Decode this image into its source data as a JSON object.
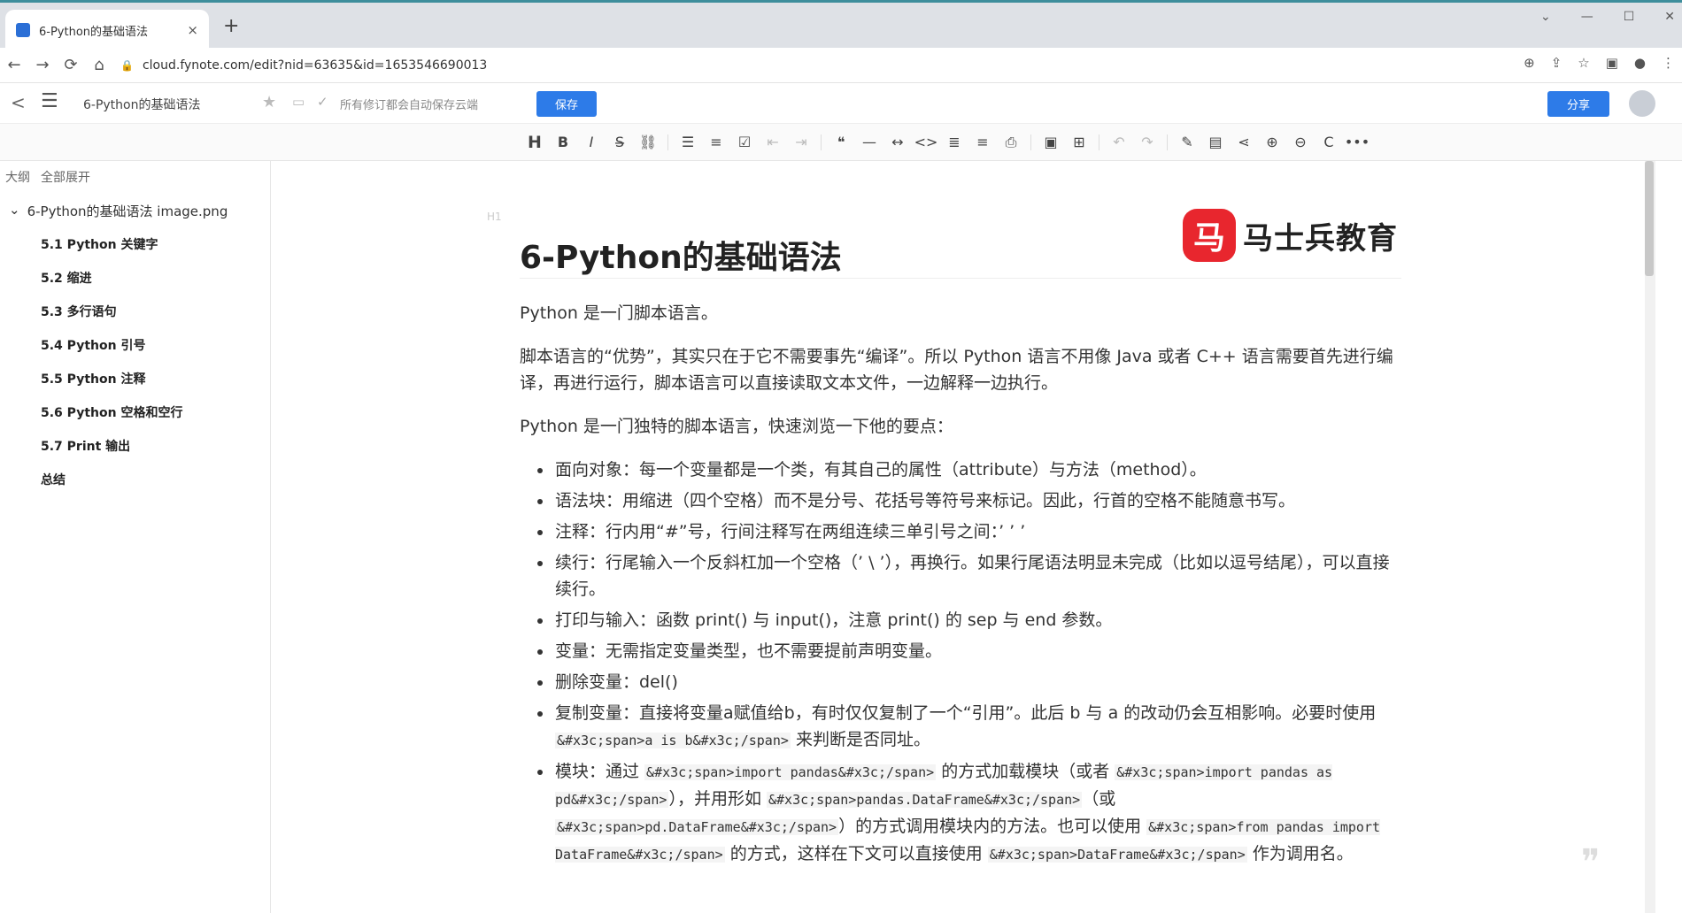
{
  "browser": {
    "tab_title": "6-Python的基础语法",
    "tab_close": "×",
    "new_tab": "+",
    "url": "cloud.fynote.com/edit?nid=63635&id=1653546690013",
    "nav": {
      "back": "←",
      "forward": "→",
      "reload": "⟳",
      "home": "⌂"
    },
    "window": {
      "chevron": "⌄",
      "minimize": "—",
      "maximize": "☐",
      "close": "✕"
    },
    "omni_icons": {
      "zoom": "⊕",
      "share": "⇪",
      "bookmark": "☆",
      "panel": "▣",
      "profile": "●",
      "more": "⋮"
    }
  },
  "header": {
    "back": "<",
    "menu": "☰",
    "doc_title": "6-Python的基础语法",
    "star": "★",
    "folder": "▭",
    "check": "✓",
    "autosave": "所有修订都会自动保存云端",
    "save_label": "保存",
    "share_label": "分享"
  },
  "toolbar": {
    "group1": [
      "H",
      "B",
      "I",
      "S̶",
      "⛓"
    ],
    "group2": [
      "☰",
      "≡",
      "☑",
      "⇤",
      "⇥"
    ],
    "group3": [
      "❝",
      "—",
      "↔",
      "<>",
      "≣",
      "≡",
      "⎙"
    ],
    "group4": [
      "▣",
      "⊞"
    ],
    "group5": [
      "↶",
      "↷"
    ],
    "group6": [
      "✎",
      "▤",
      "⋖",
      "⊕",
      "⊖",
      "C",
      "•••"
    ]
  },
  "sidebar": {
    "outline_label": "大纲",
    "expand_all_label": "全部展开",
    "root_chevron": "⌄",
    "root_label": "6-Python的基础语法 image.png",
    "items": [
      {
        "label": "5.1 Python 关键字"
      },
      {
        "label": "5.2 缩进"
      },
      {
        "label": "5.3 多行语句"
      },
      {
        "label": "5.4 Python 引号"
      },
      {
        "label": "5.5 Python 注释"
      },
      {
        "label": "5.6 Python 空格和空行"
      },
      {
        "label": "5.7 Print 输出"
      },
      {
        "label": "总结"
      }
    ]
  },
  "doc": {
    "h1_label": "H1",
    "title": "6-Python的基础语法",
    "logo_mark": "马",
    "logo_text": "马士兵教育",
    "p1": "Python 是一门脚本语言。",
    "p2": "脚本语言的“优势”，其实只在于它不需要事先“编译”。所以 Python 语言不用像 Java 或者 C++ 语言需要首先进行编译，再进行运行，脚本语言可以直接读取文本文件，一边解释一边执行。",
    "p3": "Python 是一门独特的脚本语言，快速浏览一下他的要点：",
    "bullets": [
      {
        "text": "面向对象：每一个变量都是一个类，有其自己的属性（attribute）与方法（method）。"
      },
      {
        "text": "语法块：用缩进（四个空格）而不是分号、花括号等符号来标记。因此，行首的空格不能随意书写。"
      },
      {
        "text": "注释：行内用“#”号，行间注释写在两组连续三单引号之间：’ ’ ’"
      },
      {
        "text": "续行：行尾输入一个反斜杠加一个空格（’ \\ ’），再换行。如果行尾语法明显未完成（比如以逗号结尾），可以直接续行。"
      },
      {
        "text": "打印与输入：函数 print() 与 input()，注意 print() 的 sep 与 end 参数。"
      },
      {
        "text": "变量：无需指定变量类型，也不需要提前声明变量。"
      },
      {
        "text": "删除变量：del()"
      }
    ],
    "copy_bullet": {
      "t1": "复制变量：直接将变量a赋值给b，有时仅仅复制了一个“引用”。此后 b 与 a 的改动仍会互相影响。必要时使用 ",
      "c1": "&#x3c;span>a is b&#x3c;/span>",
      "t2": " 来判断是否同址。"
    },
    "module_bullet": {
      "t1": "模块：通过 ",
      "c1": "&#x3c;span>import pandas&#x3c;/span>",
      "t2": " 的方式加载模块（或者 ",
      "c2": "&#x3c;span>import pandas as pd&#x3c;/span>",
      "t3": "），并用形如 ",
      "c3": "&#x3c;span>pandas.DataFrame&#x3c;/span>",
      "t4": "（或 ",
      "c4": "&#x3c;span>pd.DataFrame&#x3c;/span>",
      "t5": "）的方式调用模块内的方法。也可以使用 ",
      "c5": "&#x3c;span>from pandas import DataFrame&#x3c;/span>",
      "t6": " 的方式，这样在下文可以直接使用 ",
      "c6": "&#x3c;span>DataFrame&#x3c;/span>",
      "t7": " 作为调用名。"
    },
    "quote_mark": "❞"
  }
}
